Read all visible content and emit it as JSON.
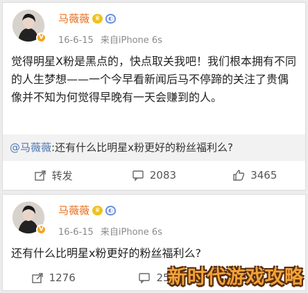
{
  "posts": [
    {
      "user": "马薇薇",
      "date": "16-6-15",
      "source": "来自iPhone 6s",
      "text": "觉得明星X粉是黑点的，快点取关我吧！我们根本拥有不同的人生梦想——一个今早看新闻后马不停蹄的关注了贵偶像并不知为何觉得早晚有一天会赚到的人。",
      "mention_user": "@马薇薇",
      "mention_text": ":还有什么比明星x粉更好的粉丝福利么?",
      "actions": [
        {
          "icon": "share-icon",
          "label": "转发"
        },
        {
          "icon": "comment-icon",
          "label": "2083"
        },
        {
          "icon": "like-icon",
          "label": "3465"
        }
      ]
    },
    {
      "user": "马薇薇",
      "date": "16-6-15",
      "source": "来自iPhone 6s",
      "text": "还有什么比明星x粉更好的粉丝福利么?",
      "actions": [
        {
          "icon": "share-icon",
          "label": "1276"
        },
        {
          "icon": "comment-icon",
          "label": "25"
        }
      ]
    }
  ],
  "badges": {
    "v": "V",
    "vip": "♛",
    "shield": "◐"
  },
  "watermark": "新时代游戏攻略",
  "colors": {
    "name": "#e86b1a",
    "mention": "#4a76b3",
    "meta": "#8a8a8a"
  }
}
